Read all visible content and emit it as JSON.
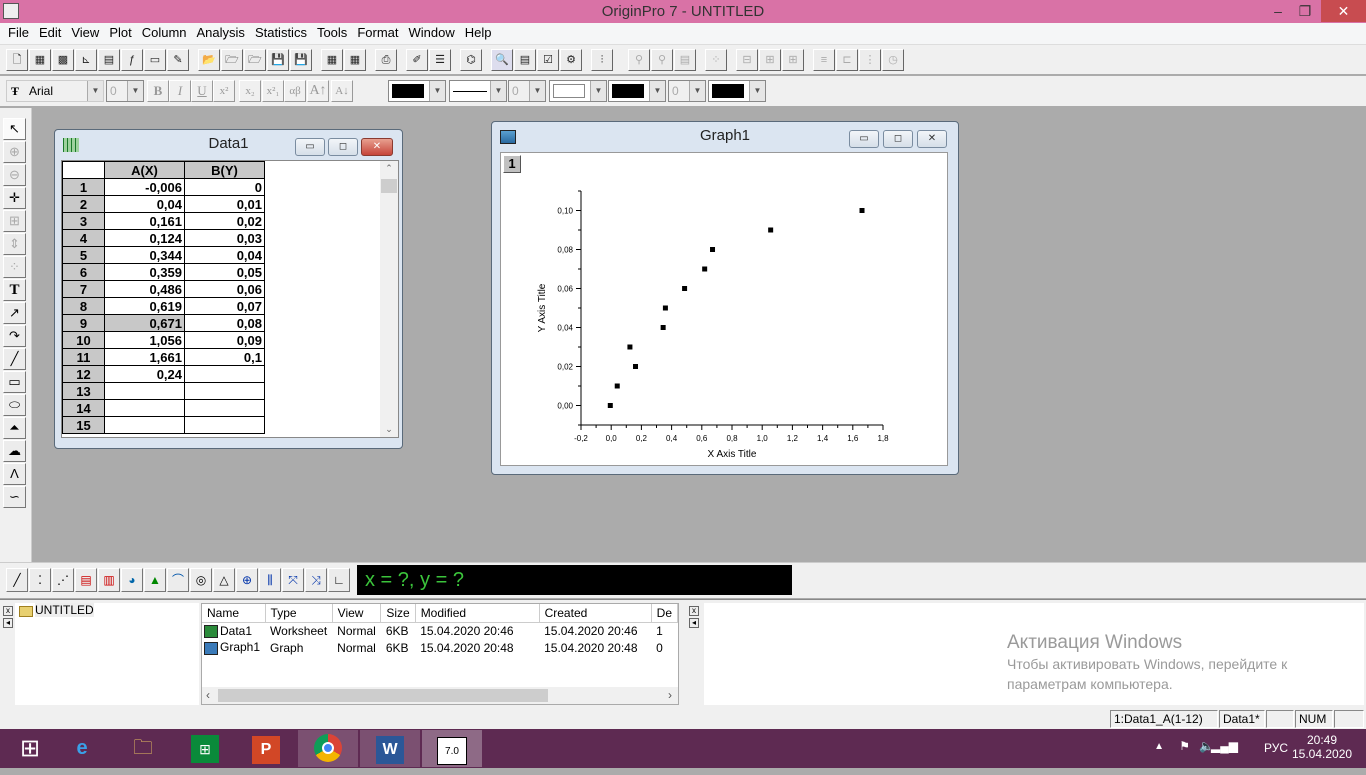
{
  "app": {
    "title": "OriginPro 7 - UNTITLED",
    "window_controls": {
      "minimize": "–",
      "restore": "❐",
      "close": "✕"
    }
  },
  "menu": [
    "File",
    "Edit",
    "View",
    "Plot",
    "Column",
    "Analysis",
    "Statistics",
    "Tools",
    "Format",
    "Window",
    "Help"
  ],
  "format_toolbar": {
    "font_name": "Arial",
    "font_size": "0",
    "line_width": "0",
    "symbol_size": "0",
    "buttons": [
      "B",
      "I",
      "U",
      "x²",
      "x₂",
      "x²₁",
      "αβ",
      "A↑",
      "A↓"
    ]
  },
  "worksheet": {
    "title": "Data1",
    "columns": [
      "A(X)",
      "B(Y)"
    ],
    "rows": [
      {
        "n": "1",
        "a": "-0,006",
        "b": "0"
      },
      {
        "n": "2",
        "a": "0,04",
        "b": "0,01"
      },
      {
        "n": "3",
        "a": "0,161",
        "b": "0,02"
      },
      {
        "n": "4",
        "a": "0,124",
        "b": "0,03"
      },
      {
        "n": "5",
        "a": "0,344",
        "b": "0,04"
      },
      {
        "n": "6",
        "a": "0,359",
        "b": "0,05"
      },
      {
        "n": "7",
        "a": "0,486",
        "b": "0,06"
      },
      {
        "n": "8",
        "a": "0,619",
        "b": "0,07"
      },
      {
        "n": "9",
        "a": "0,671",
        "b": "0,08"
      },
      {
        "n": "10",
        "a": "1,056",
        "b": "0,09"
      },
      {
        "n": "11",
        "a": "1,661",
        "b": "0,1"
      },
      {
        "n": "12",
        "a": "0,24",
        "b": ""
      },
      {
        "n": "13",
        "a": "",
        "b": ""
      },
      {
        "n": "14",
        "a": "",
        "b": ""
      },
      {
        "n": "15",
        "a": "",
        "b": ""
      }
    ],
    "selected_row": "9"
  },
  "graph": {
    "title": "Graph1",
    "layer_label": "1"
  },
  "chart_data": {
    "type": "scatter",
    "title": "",
    "xlabel": "X  Axis Title",
    "ylabel": "Y Axis Title",
    "xlim": [
      -0.2,
      1.8
    ],
    "ylim": [
      -0.01,
      0.11
    ],
    "xticks": [
      "-0,2",
      "0,0",
      "0,2",
      "0,4",
      "0,6",
      "0,8",
      "1,0",
      "1,2",
      "1,4",
      "1,6",
      "1,8"
    ],
    "xtick_values": [
      -0.2,
      0,
      0.2,
      0.4,
      0.6,
      0.8,
      1.0,
      1.2,
      1.4,
      1.6,
      1.8
    ],
    "yticks": [
      "0,00",
      "0,02",
      "0,04",
      "0,06",
      "0,08",
      "0,10"
    ],
    "ytick_values": [
      0,
      0.02,
      0.04,
      0.06,
      0.08,
      0.1
    ],
    "grid": false,
    "series": [
      {
        "name": "B",
        "x": [
          -0.006,
          0.04,
          0.161,
          0.124,
          0.344,
          0.359,
          0.486,
          0.619,
          0.671,
          1.056,
          1.661
        ],
        "y": [
          0,
          0.01,
          0.02,
          0.03,
          0.04,
          0.05,
          0.06,
          0.07,
          0.08,
          0.09,
          0.1
        ],
        "marker": "square",
        "color": "#000000"
      }
    ]
  },
  "coords_readout": "x = ?, y = ?",
  "explorer": {
    "folder": "UNTITLED",
    "columns": [
      "Name",
      "Type",
      "View",
      "Size",
      "Modified",
      "Created",
      "De"
    ],
    "items": [
      {
        "name": "Data1",
        "type": "Worksheet",
        "view": "Normal",
        "size": "6KB",
        "modified": "15.04.2020 20:46",
        "created": "15.04.2020 20:46",
        "de": "1"
      },
      {
        "name": "Graph1",
        "type": "Graph",
        "view": "Normal",
        "size": "6KB",
        "modified": "15.04.2020 20:48",
        "created": "15.04.2020 20:48",
        "de": "0"
      }
    ]
  },
  "watermark": {
    "heading": "Активация Windows",
    "line1": "Чтобы активировать Windows, перейдите к",
    "line2": "параметрам компьютера."
  },
  "status": {
    "selection": "1:Data1_A(1-12)",
    "window": "Data1*",
    "blank": "",
    "num": "NUM"
  },
  "taskbar": {
    "lang": "РУС",
    "time": "20:49",
    "date": "15.04.2020"
  }
}
